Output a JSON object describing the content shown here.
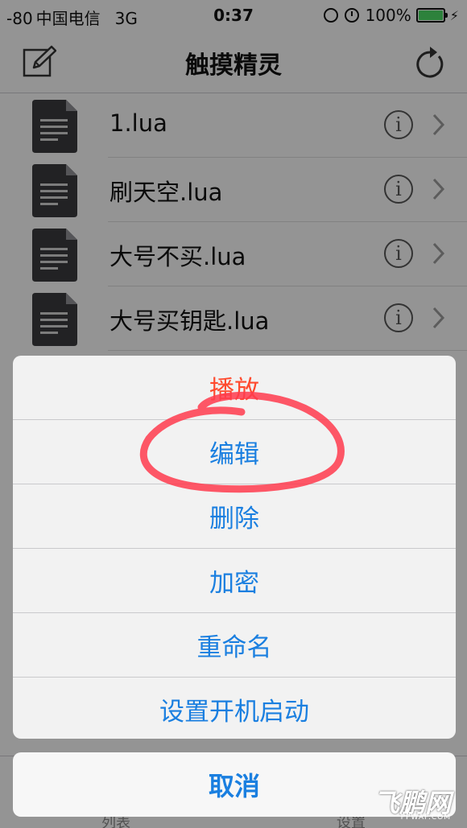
{
  "status_bar": {
    "signal": "-80",
    "carrier": "中国电信",
    "network": "3G",
    "time": "0:37",
    "battery": "100%"
  },
  "nav": {
    "title": "触摸精灵"
  },
  "files": [
    {
      "name": "1.lua"
    },
    {
      "name": "刷天空.lua"
    },
    {
      "name": "大号不买.lua"
    },
    {
      "name": "大号买钥匙.lua"
    }
  ],
  "action_sheet": {
    "items": [
      {
        "label": "播放"
      },
      {
        "label": "编辑"
      },
      {
        "label": "删除"
      },
      {
        "label": "加密"
      },
      {
        "label": "重命名"
      },
      {
        "label": "设置开机启动"
      }
    ],
    "cancel": "取消"
  },
  "tab_bar": {
    "tabs": [
      {
        "label": "列表"
      },
      {
        "label": "设置"
      }
    ]
  },
  "watermark": {
    "text": "飞鹏网",
    "sub": "PPWAP.COM"
  },
  "colors": {
    "accent": "#1a7fe0",
    "destructive": "#ff4a2e",
    "annotation": "#ff3b4e",
    "battery": "#4cd964"
  }
}
